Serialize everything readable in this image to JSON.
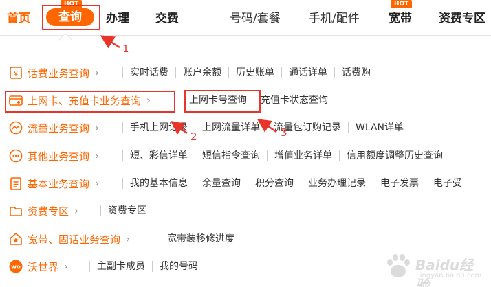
{
  "nav": {
    "home": "首页",
    "query": "查询",
    "handle": "办理",
    "pay": "交费",
    "number_plan": "号码/套餐",
    "phone_accessories": "手机/配件",
    "broadband": "宽带",
    "tariff_zone": "资费专区",
    "hot_badge": "HOT"
  },
  "menu": {
    "rows": [
      {
        "label": "话费业务查询",
        "icon": "money-icon",
        "links": [
          "实时话费",
          "账户余额",
          "历史账单",
          "通话详单",
          "话费购"
        ]
      },
      {
        "label": "上网卡、充值卡业务查询",
        "icon": "card-icon",
        "links": [
          "上网卡号查询",
          "充值卡状态查询"
        ]
      },
      {
        "label": "流量业务查询",
        "icon": "flow-icon",
        "links": [
          "手机上网记录",
          "上网流量详单",
          "流量包订购记录",
          "WLAN详单"
        ]
      },
      {
        "label": "其他业务查询",
        "icon": "chat-icon",
        "links": [
          "短、彩信详单",
          "短信指令查询",
          "增值业务详单",
          "信用额度调整历史查询"
        ]
      },
      {
        "label": "基本业务查询",
        "icon": "clipboard-icon",
        "links": [
          "我的基本信息",
          "余量查询",
          "积分查询",
          "业务办理记录",
          "电子发票",
          "电子受"
        ]
      },
      {
        "label": "资费专区",
        "icon": "folder-icon",
        "links": [
          "资费专区"
        ]
      },
      {
        "label": "宽带、固话业务查询",
        "icon": "house-icon",
        "links": [
          "宽带装移修进度"
        ]
      },
      {
        "label": "沃世界",
        "icon": "wo-icon",
        "links": [
          "主副卡成员",
          "我的号码"
        ]
      }
    ]
  },
  "annotations": {
    "n1": "1",
    "n2": "2",
    "n3": "3"
  },
  "watermark": {
    "brand": "Baidu经验",
    "url": "jingyan.baidu.com"
  },
  "colors": {
    "accent": "#ff6600",
    "annotation": "#e8352c"
  }
}
